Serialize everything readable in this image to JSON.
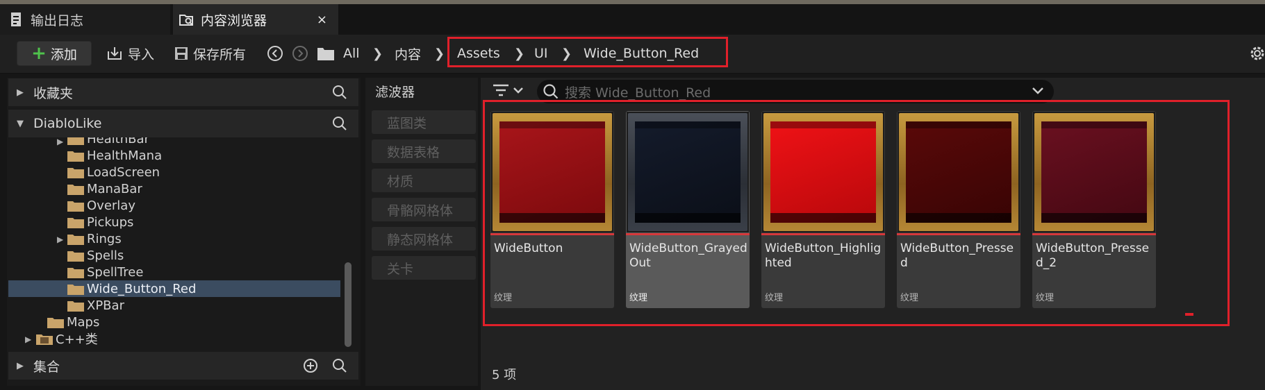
{
  "tabs": [
    {
      "label": "输出日志"
    },
    {
      "label": "内容浏览器",
      "close": "×"
    }
  ],
  "toolbar": {
    "add_label": "添加",
    "import_label": "导入",
    "save_all_label": "保存所有",
    "breadcrumb": [
      "All",
      "内容",
      "Assets",
      "UI",
      "Wide_Button_Red"
    ]
  },
  "left_panel": {
    "favorites_label": "收藏夹",
    "project_label": "DiabloLike",
    "collections_label": "集合",
    "tree": [
      {
        "label": "HealthBar"
      },
      {
        "label": "HealthMana"
      },
      {
        "label": "LoadScreen"
      },
      {
        "label": "ManaBar"
      },
      {
        "label": "Overlay"
      },
      {
        "label": "Pickups"
      },
      {
        "label": "Rings"
      },
      {
        "label": "Spells"
      },
      {
        "label": "SpellTree"
      },
      {
        "label": "Wide_Button_Red",
        "selected": true
      },
      {
        "label": "XPBar"
      },
      {
        "label": "Maps"
      },
      {
        "label": "C++类"
      }
    ]
  },
  "filters": {
    "title": "滤波器",
    "items": [
      "蓝图类",
      "数据表格",
      "材质",
      "骨骼网格体",
      "静态网格体",
      "关卡"
    ]
  },
  "search": {
    "placeholder": "搜索 Wide_Button_Red"
  },
  "assets": [
    {
      "name": "WideButton",
      "type": "纹理",
      "color": "#9a0f12"
    },
    {
      "name": "WideButton_GrayedOut",
      "type": "纹理",
      "color": "#0f1522"
    },
    {
      "name": "WideButton_Highlighted",
      "type": "纹理",
      "color": "#d20a0d"
    },
    {
      "name": "WideButton_Pressed",
      "type": "纹理",
      "color": "#4a0707"
    },
    {
      "name": "WideButton_Pressed_2",
      "type": "纹理",
      "color": "#5a0d18"
    }
  ],
  "status": {
    "count": "5 项"
  },
  "colors": {
    "highlight": "#e0202a",
    "selection": "#3b4c60",
    "add_plus": "#4fc24c"
  }
}
